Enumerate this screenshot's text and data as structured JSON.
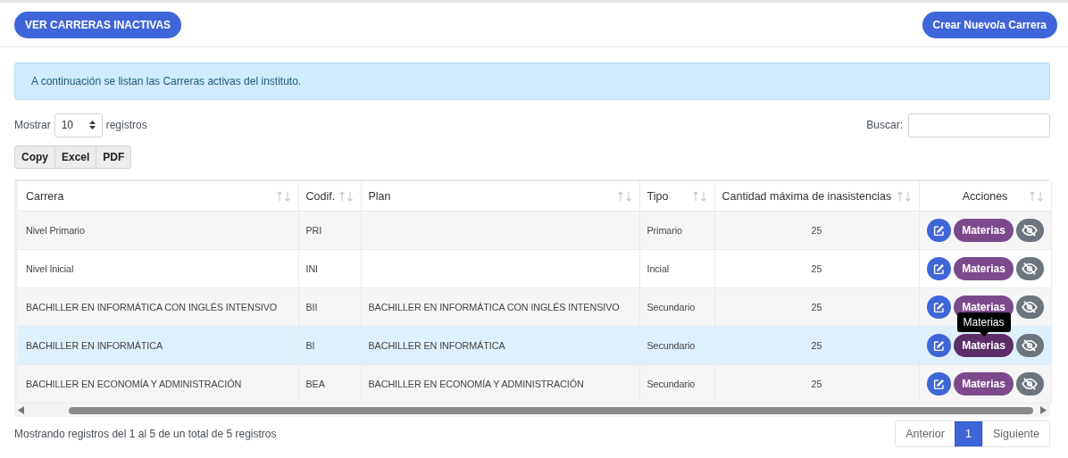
{
  "top_buttons": [
    "VER CARRERAS INACTIVAS",
    "Crear Nuevo/a Carrera"
  ],
  "alert": "A continuación se listan las Carreras activas del instituto.",
  "length_menu": {
    "before": "Mostrar",
    "value": "10",
    "after": "registros"
  },
  "search": {
    "label": "Buscar:"
  },
  "export_buttons": [
    "Copy",
    "Excel",
    "PDF"
  ],
  "table": {
    "columns": [
      "Carrera",
      "Codif.",
      "Plan",
      "Tipo",
      "Cantidad máxima de inasistencias",
      "Acciones"
    ],
    "rows": [
      {
        "cells": [
          "Nivel Primario",
          "PRI",
          "",
          "Primario",
          "25"
        ],
        "action_label": "Materias",
        "hovered": false
      },
      {
        "cells": [
          "Nivel Inicial",
          "INI",
          "",
          "Incial",
          "25"
        ],
        "action_label": "Materias",
        "hovered": false
      },
      {
        "cells": [
          "BACHILLER EN INFORMÁTICA CON INGLÉS INTENSIVO",
          "BII",
          "BACHILLER EN INFORMÁTICA CON INGLÉS INTENSIVO",
          "Secundario",
          "25"
        ],
        "action_label": "Materias",
        "hovered": false
      },
      {
        "cells": [
          "BACHILLER EN INFORMÁTICA",
          "BI",
          "BACHILLER EN INFORMÁTICA",
          "Secundario",
          "25"
        ],
        "action_label": "Materias",
        "hovered": true,
        "tooltip": "Materias"
      },
      {
        "cells": [
          "BACHILLER EN ECONOMÍA Y ADMINISTRACIÓN",
          "BEA",
          "BACHILLER EN ECONOMÍA Y ADMINISTRACIÓN",
          "Secundario",
          "25"
        ],
        "action_label": "Materias",
        "hovered": false
      }
    ]
  },
  "info": "Mostrando registros del 1 al 5 de un total de 5 registros",
  "pagination": [
    {
      "label": "Anterior",
      "selected": false
    },
    {
      "label": "1",
      "selected": true
    },
    {
      "label": "Siguiente",
      "selected": false
    }
  ]
}
